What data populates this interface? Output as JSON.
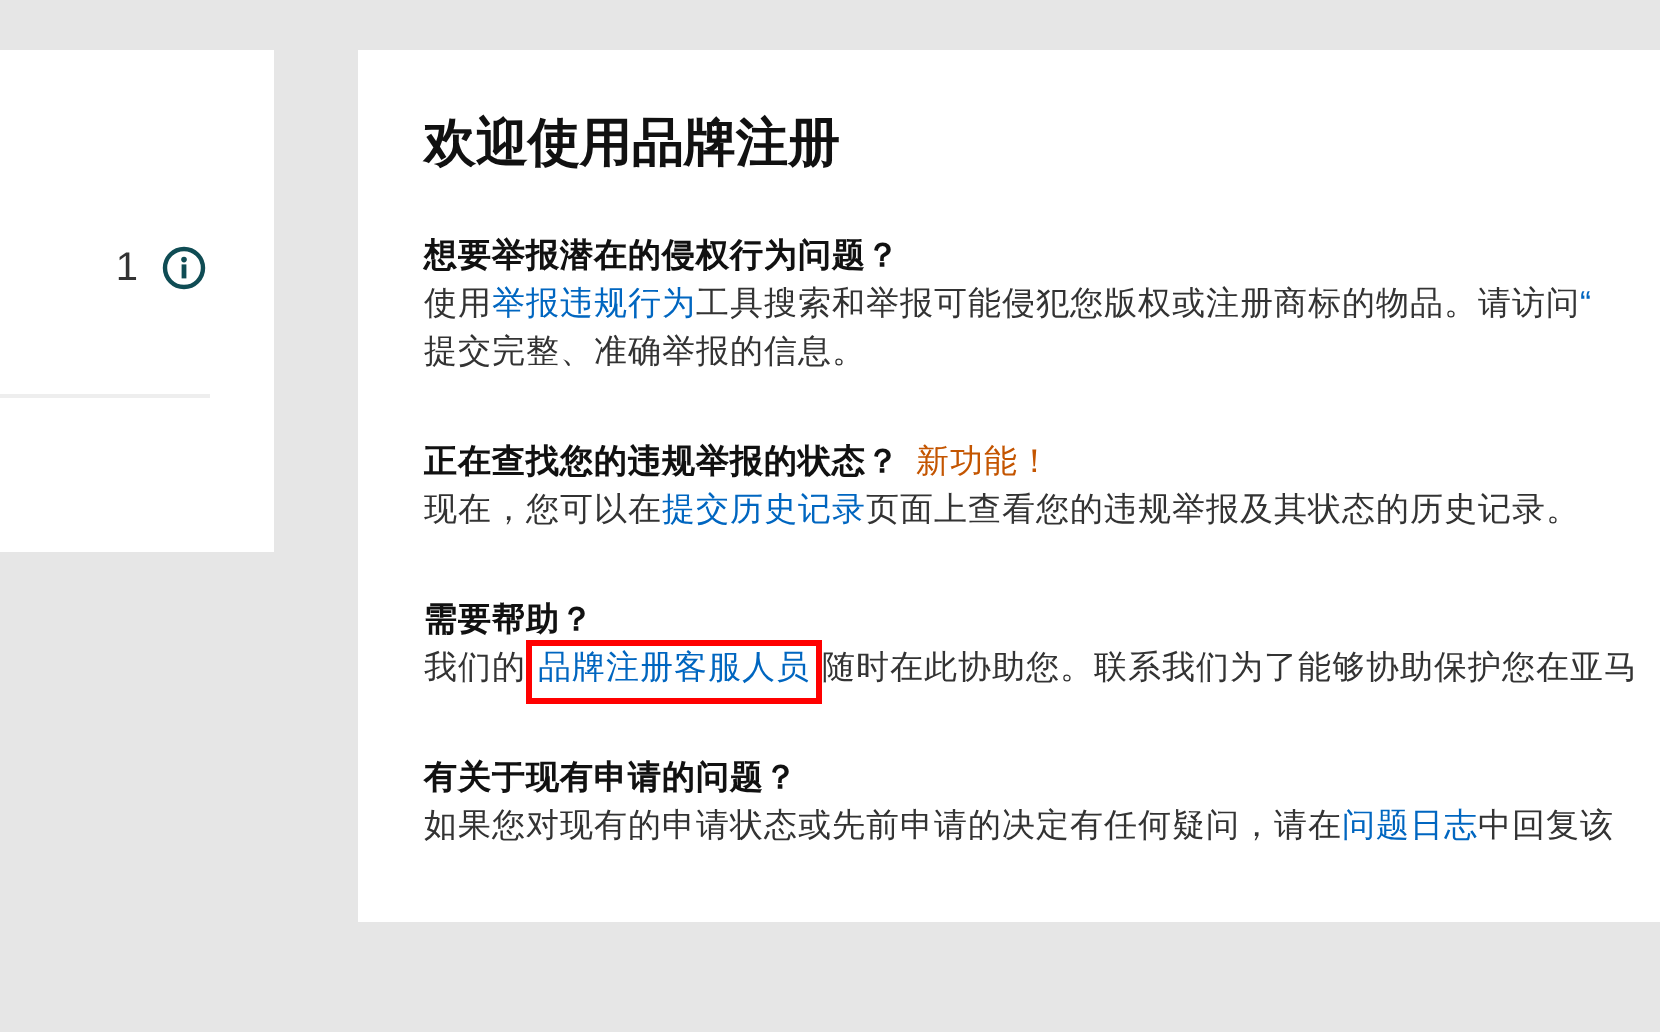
{
  "summary_card": {
    "count": "1"
  },
  "main": {
    "title": "欢迎使用品牌注册",
    "sections": [
      {
        "heading": "想要举报潜在的侵权行为问题？",
        "lines": [
          [
            {
              "text": "使用",
              "kind": "text"
            },
            {
              "text": "举报违规行为",
              "kind": "link"
            },
            {
              "text": "工具搜索和举报可能侵犯您版权或注册商标的物品。请访问 ",
              "kind": "text"
            },
            {
              "text": "“",
              "kind": "link"
            }
          ],
          [
            {
              "text": "提交完整、准确举报的信息。",
              "kind": "text"
            }
          ]
        ]
      },
      {
        "heading": "正在查找您的违规举报的状态？",
        "badge": "新功能！",
        "lines": [
          [
            {
              "text": "现在，您可以在 ",
              "kind": "text"
            },
            {
              "text": "提交历史记录",
              "kind": "link"
            },
            {
              "text": " 页面上查看您的违规举报及其状态的历史记录。",
              "kind": "text"
            }
          ]
        ]
      },
      {
        "heading": "需要帮助？",
        "highlighted": true,
        "lines": [
          [
            {
              "text": "我们的",
              "kind": "text"
            },
            {
              "text": "品牌注册客服人员",
              "kind": "link"
            },
            {
              "text": "随时在此协助您。联系我们为了能够协助保护您在亚马",
              "kind": "text"
            }
          ]
        ]
      },
      {
        "heading": "有关于现有申请的问题？",
        "lines": [
          [
            {
              "text": "如果您对现有的申请状态或先前申请的决定有任何疑问，请在",
              "kind": "text"
            },
            {
              "text": "问题日志",
              "kind": "link"
            },
            {
              "text": "中回复该",
              "kind": "text"
            }
          ]
        ]
      }
    ]
  }
}
